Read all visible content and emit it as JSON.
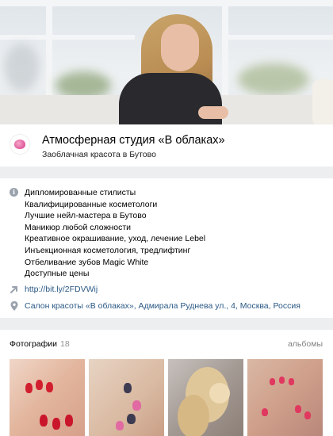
{
  "header": {
    "title": "Атмосферная студия «В облаках»",
    "status": "Заоблачная красота в Бутово"
  },
  "info": {
    "description_lines": [
      "Дипломированные стилисты",
      "Квалифицированные косметологи",
      "Лучшие нейл-мастера в Бутово",
      "Маникюр любой сложности",
      "Креативное окрашивание, уход, лечение Lebel",
      "Инъекционная косметология, тредлифтинг",
      "Отбеливание зубов Magic White",
      "Доступные цены"
    ],
    "link": "http://bit.ly/2FDVWij",
    "address": "Салон красоты «В облаках», Адмирала Руднева ул., 4, Москва, Россия"
  },
  "photos": {
    "title": "Фотографии",
    "count": "18",
    "albums_label": "альбомы"
  },
  "icons": {
    "info": "info-icon",
    "link": "link-arrow-icon",
    "address": "map-pin-icon"
  },
  "colors": {
    "link": "#2a5885",
    "muted": "#939393",
    "icon_gray": "#99a2ad",
    "background": "#edeef0"
  }
}
